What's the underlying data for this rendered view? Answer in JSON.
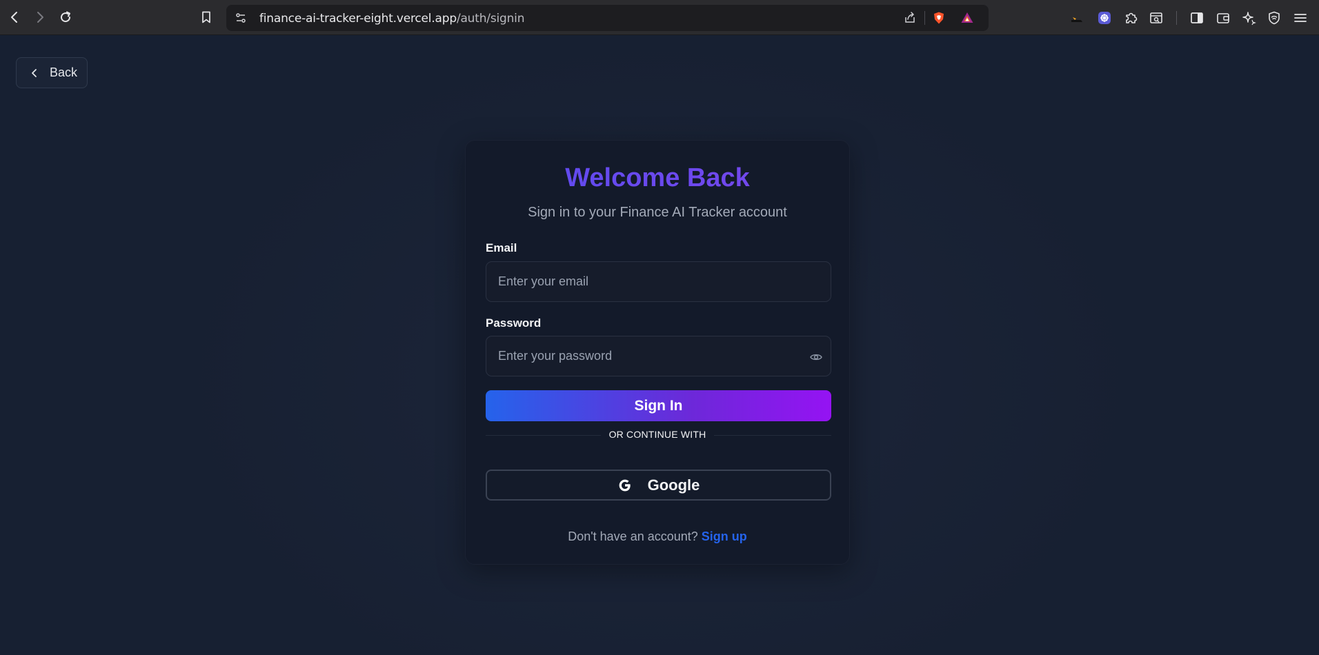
{
  "browser": {
    "url_host": "finance-ai-tracker-eight.vercel.app",
    "url_path": "/auth/signin",
    "icons": [
      "back-icon",
      "forward-icon",
      "reload-icon",
      "bookmark-icon",
      "site-settings-icon",
      "share-icon",
      "brave-shields-icon",
      "brave-rewards-icon",
      "extension-icon",
      "extension-puzzle-icon",
      "screenshot-icon",
      "sidebar-icon",
      "wallet-icon",
      "leo-ai-icon",
      "vpn-icon",
      "menu-icon"
    ]
  },
  "page": {
    "back_label": "Back",
    "title": "Welcome Back",
    "subtitle": "Sign in to your Finance AI Tracker account",
    "email_label": "Email",
    "email_placeholder": "Enter your email",
    "password_label": "Password",
    "password_placeholder": "Enter your password",
    "signin_label": "Sign In",
    "divider_text": "OR CONTINUE WITH",
    "google_label": "Google",
    "footer_text": "Don't have an account?",
    "signup_label": "Sign up"
  },
  "colors": {
    "background": "#172032",
    "card": "#131a2a",
    "title": "#5a4cf0",
    "button_gradient_start": "#2563eb",
    "button_gradient_end": "#9513f3",
    "link": "#2563eb"
  }
}
